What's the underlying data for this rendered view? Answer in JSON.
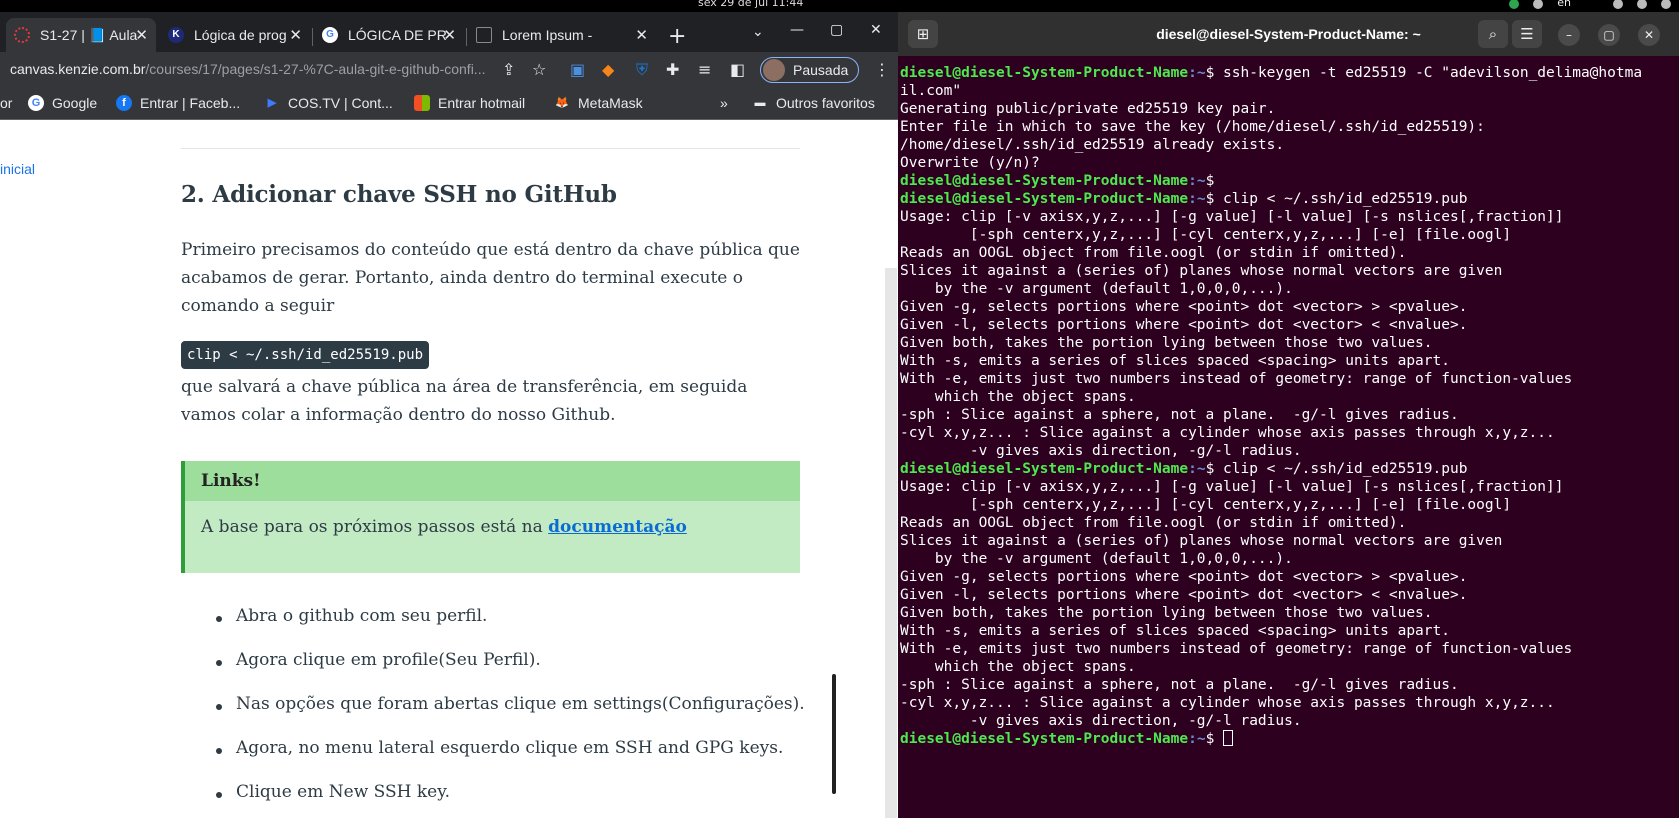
{
  "system": {
    "clock": "sex 29 de jul  11:44",
    "language": "en"
  },
  "browser": {
    "tabs": [
      {
        "title": "S1-27 | 📘 Aula",
        "color": "#e53935"
      },
      {
        "title": "Lógica de prog",
        "color": "#1e2a78"
      },
      {
        "title": "LÓGICA DE PR",
        "color": "#4285f4"
      },
      {
        "title": "Lorem Ipsum -",
        "color": "#555555"
      }
    ],
    "new_tab": "+",
    "url_host": "canvas.kenzie.com.br",
    "url_path": "/courses/17/pages/s1-27-%7C-aula-git-e-github-confi...",
    "profile_label": "Pausada",
    "bookmarks": [
      {
        "label": "or",
        "icon": ""
      },
      {
        "label": "Google",
        "icon": "G"
      },
      {
        "label": "Entrar | Faceb...",
        "icon": "f"
      },
      {
        "label": "COS.TV | Cont...",
        "icon": "▶"
      },
      {
        "label": "Entrar hotmail",
        "icon": "■"
      },
      {
        "label": "MetaMask",
        "icon": "🦊"
      }
    ],
    "bookmarks_more": "»",
    "other_favorites": "Outros favoritos"
  },
  "page": {
    "side_link": "inicial",
    "heading": "2. Adicionar chave SSH no GitHub",
    "para1": "Primeiro precisamos do conteúdo que está dentro da chave pública que acabamos de gerar. Portanto, ainda dentro do terminal execute o comando a seguir",
    "code": "clip < ~/.ssh/id_ed25519.pub",
    "para2": "que salvará a chave pública na área de transferência, em seguida vamos colar a informação dentro do nosso Github.",
    "callout_title": "Links!",
    "callout_text": "A base para os próximos passos está na ",
    "callout_link": "documentação",
    "steps": [
      "Abra o github com seu perfil.",
      "Agora clique em profile(Seu Perfil).",
      "Nas opções que foram abertas clique em settings(Configurações).",
      "Agora, no menu lateral esquerdo clique em SSH and GPG keys.",
      "Clique em New SSH key."
    ]
  },
  "terminal": {
    "title": "diesel@diesel-System-Product-Name: ~",
    "prompt_user": "diesel@diesel-System-Product-Name",
    "prompt_path": ":~",
    "lines": [
      {
        "prompt": true,
        "text": "$ ssh-keygen -t ed25519 -C \"adevilson_delima@hotma"
      },
      {
        "prompt": false,
        "text": "il.com\""
      },
      {
        "prompt": false,
        "text": "Generating public/private ed25519 key pair."
      },
      {
        "prompt": false,
        "text": "Enter file in which to save the key (/home/diesel/.ssh/id_ed25519):"
      },
      {
        "prompt": false,
        "text": "/home/diesel/.ssh/id_ed25519 already exists."
      },
      {
        "prompt": false,
        "text": "Overwrite (y/n)?"
      },
      {
        "prompt": true,
        "text": "$"
      },
      {
        "prompt": true,
        "text": "$ clip < ~/.ssh/id_ed25519.pub"
      },
      {
        "prompt": false,
        "text": "Usage: clip [-v axisx,y,z,...] [-g value] [-l value] [-s nslices[,fraction]]"
      },
      {
        "prompt": false,
        "text": "        [-sph centerx,y,z,...] [-cyl centerx,y,z,...] [-e] [file.oogl]"
      },
      {
        "prompt": false,
        "text": "Reads an OOGL object from file.oogl (or stdin if omitted)."
      },
      {
        "prompt": false,
        "text": "Slices it against a (series of) planes whose normal vectors are given"
      },
      {
        "prompt": false,
        "text": "    by the -v argument (default 1,0,0,0,...)."
      },
      {
        "prompt": false,
        "text": "Given -g, selects portions where <point> dot <vector> > <pvalue>."
      },
      {
        "prompt": false,
        "text": "Given -l, selects portions where <point> dot <vector> < <nvalue>."
      },
      {
        "prompt": false,
        "text": "Given both, takes the portion lying between those two values."
      },
      {
        "prompt": false,
        "text": "With -s, emits a series of slices spaced <spacing> units apart."
      },
      {
        "prompt": false,
        "text": "With -e, emits just two numbers instead of geometry: range of function-values"
      },
      {
        "prompt": false,
        "text": "    which the object spans."
      },
      {
        "prompt": false,
        "text": "-sph : Slice against a sphere, not a plane.  -g/-l gives radius."
      },
      {
        "prompt": false,
        "text": "-cyl x,y,z... : Slice against a cylinder whose axis passes through x,y,z..."
      },
      {
        "prompt": false,
        "text": "        -v gives axis direction, -g/-l radius."
      },
      {
        "prompt": true,
        "text": "$ clip < ~/.ssh/id_ed25519.pub"
      },
      {
        "prompt": false,
        "text": "Usage: clip [-v axisx,y,z,...] [-g value] [-l value] [-s nslices[,fraction]]"
      },
      {
        "prompt": false,
        "text": "        [-sph centerx,y,z,...] [-cyl centerx,y,z,...] [-e] [file.oogl]"
      },
      {
        "prompt": false,
        "text": "Reads an OOGL object from file.oogl (or stdin if omitted)."
      },
      {
        "prompt": false,
        "text": "Slices it against a (series of) planes whose normal vectors are given"
      },
      {
        "prompt": false,
        "text": "    by the -v argument (default 1,0,0,0,...)."
      },
      {
        "prompt": false,
        "text": "Given -g, selects portions where <point> dot <vector> > <pvalue>."
      },
      {
        "prompt": false,
        "text": "Given -l, selects portions where <point> dot <vector> < <nvalue>."
      },
      {
        "prompt": false,
        "text": "Given both, takes the portion lying between those two values."
      },
      {
        "prompt": false,
        "text": "With -s, emits a series of slices spaced <spacing> units apart."
      },
      {
        "prompt": false,
        "text": "With -e, emits just two numbers instead of geometry: range of function-values"
      },
      {
        "prompt": false,
        "text": "    which the object spans."
      },
      {
        "prompt": false,
        "text": "-sph : Slice against a sphere, not a plane.  -g/-l gives radius."
      },
      {
        "prompt": false,
        "text": "-cyl x,y,z... : Slice against a cylinder whose axis passes through x,y,z..."
      },
      {
        "prompt": false,
        "text": "        -v gives axis direction, -g/-l radius."
      },
      {
        "prompt": true,
        "text": "$ ",
        "cursor": true
      }
    ]
  }
}
